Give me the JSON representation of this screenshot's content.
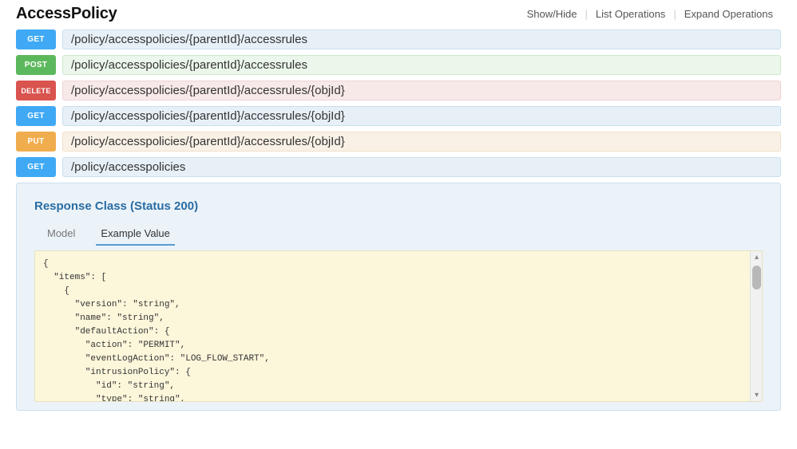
{
  "header": {
    "title": "AccessPolicy",
    "actions": [
      "Show/Hide",
      "List Operations",
      "Expand Operations"
    ]
  },
  "endpoints": [
    {
      "method": "GET",
      "path": "/policy/accesspolicies/{parentId}/accessrules",
      "mclass": "method-get",
      "pclass": "path-get"
    },
    {
      "method": "POST",
      "path": "/policy/accesspolicies/{parentId}/accessrules",
      "mclass": "method-post",
      "pclass": "path-post"
    },
    {
      "method": "DELETE",
      "path": "/policy/accesspolicies/{parentId}/accessrules/{objId}",
      "mclass": "method-delete",
      "pclass": "path-delete"
    },
    {
      "method": "GET",
      "path": "/policy/accesspolicies/{parentId}/accessrules/{objId}",
      "mclass": "method-get",
      "pclass": "path-get"
    },
    {
      "method": "PUT",
      "path": "/policy/accesspolicies/{parentId}/accessrules/{objId}",
      "mclass": "method-put",
      "pclass": "path-put"
    },
    {
      "method": "GET",
      "path": "/policy/accesspolicies",
      "mclass": "method-get",
      "pclass": "path-get"
    }
  ],
  "response": {
    "heading": "Response Class (Status 200)",
    "tabs": {
      "model": "Model",
      "example": "Example Value"
    },
    "code": "{\n  \"items\": [\n    {\n      \"version\": \"string\",\n      \"name\": \"string\",\n      \"defaultAction\": {\n        \"action\": \"PERMIT\",\n        \"eventLogAction\": \"LOG_FLOW_START\",\n        \"intrusionPolicy\": {\n          \"id\": \"string\",\n          \"type\": \"string\","
  }
}
